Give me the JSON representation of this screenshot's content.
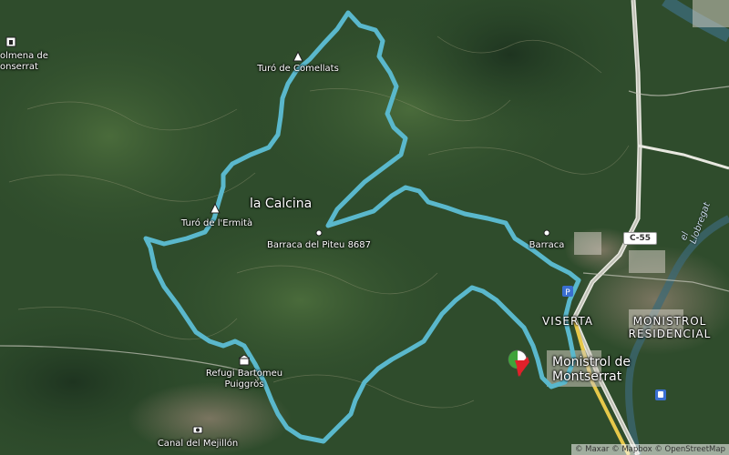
{
  "map": {
    "places": {
      "monistrol_town": "Monistrol de\nMontserrat",
      "monistrol_residencial": "MONISTROL\nRESIDENCIAL",
      "viserta": "VISERTA",
      "la_calcina": "la Calcina",
      "colmena": "olmena de\nonserrat",
      "barraca": "Barraca"
    },
    "pois": {
      "turo_comellats": "Turó de Comellats",
      "turo_ermita": "Turó de l'Ermità",
      "barraca_piteu": "Barraca del Piteu 8687",
      "refugi": "Refugi Bartomeu\nPuiggròs",
      "canal": "Canal del Mejillón"
    },
    "roads": {
      "c55": "C-55"
    },
    "rivers": {
      "llobregat": "el Llobregat"
    },
    "route_color": "#5ab8cc",
    "attribution": "© Maxar © Mapbox © OpenStreetMap"
  }
}
